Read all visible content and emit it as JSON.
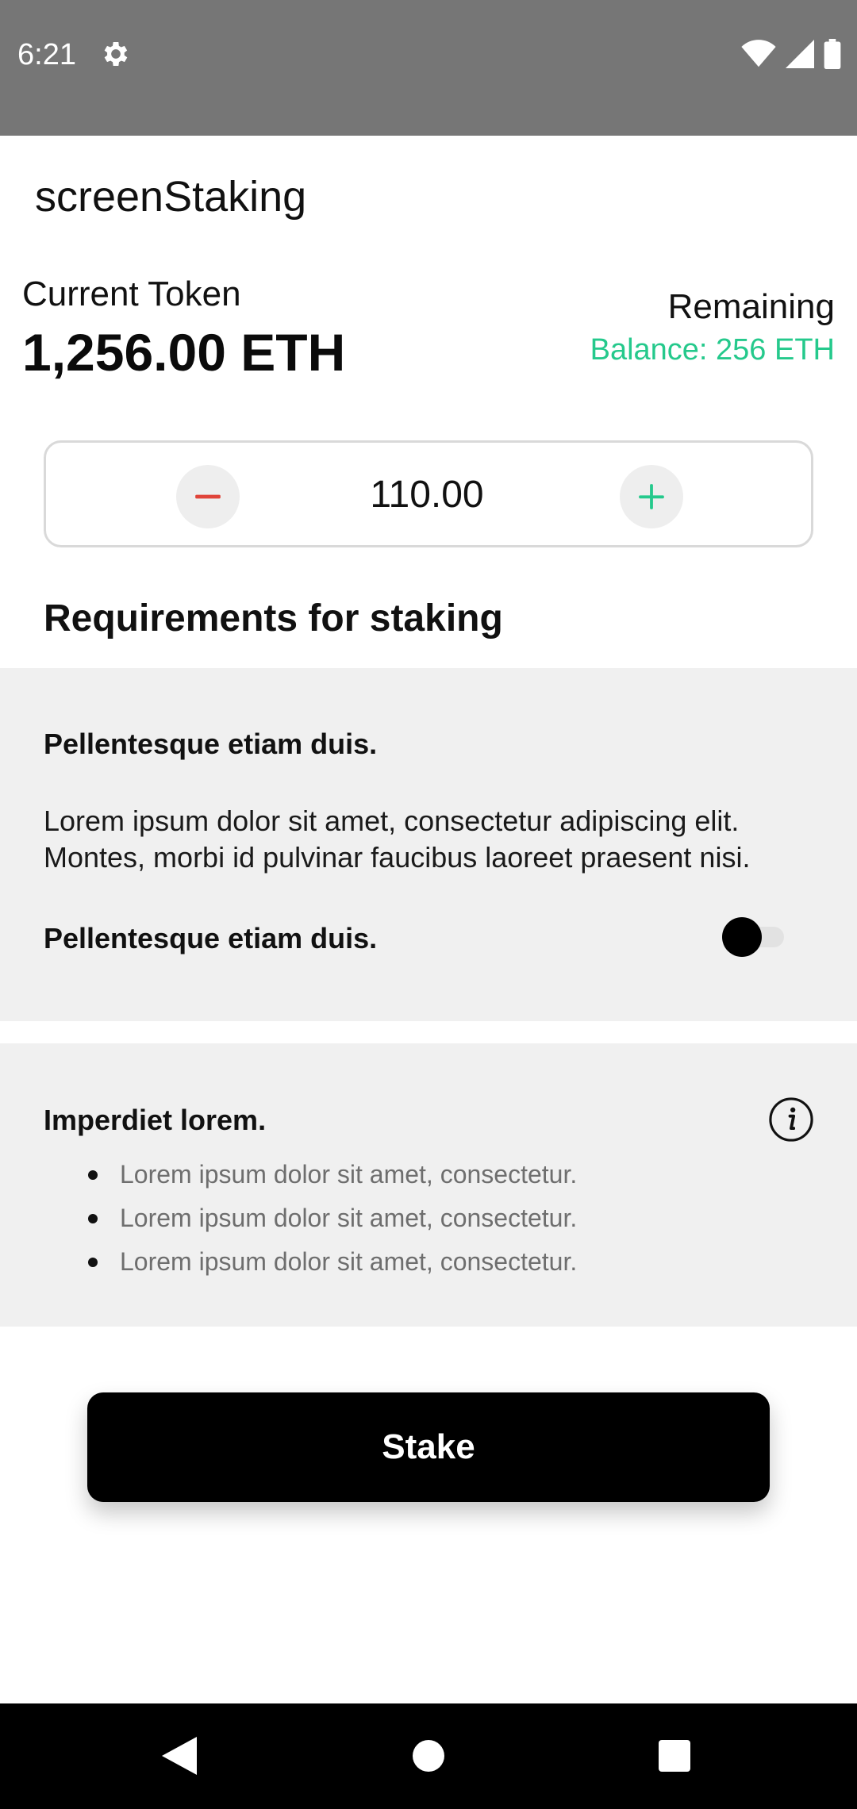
{
  "status_bar": {
    "time": "6:21",
    "icons": [
      "gear-icon",
      "wifi-icon",
      "cell-signal-icon",
      "battery-icon"
    ]
  },
  "app_bar": {
    "title": "screenStaking"
  },
  "token": {
    "current_label": "Current Token",
    "current_value": "1,256.00 ETH",
    "remaining_label": "Remaining",
    "remaining_balance": "Balance: 256 ETH"
  },
  "stepper": {
    "value": "110.00",
    "minus_icon": "minus-icon",
    "plus_icon": "plus-icon"
  },
  "requirements": {
    "title": "Requirements for staking",
    "card1": {
      "heading1": "Pellentesque etiam duis.",
      "body": "Lorem ipsum dolor sit amet, consectetur adipiscing elit. Montes, morbi id pulvinar faucibus laoreet praesent nisi.",
      "heading2": "Pellentesque etiam duis.",
      "toggle_on": false
    },
    "card2": {
      "heading": "Imperdiet lorem.",
      "info_icon": "info-icon",
      "items": [
        "Lorem ipsum dolor sit amet, consectetur.",
        "Lorem ipsum dolor sit amet, consectetur.",
        "Lorem ipsum dolor sit amet, consectetur."
      ]
    }
  },
  "stake_button": {
    "label": "Stake"
  },
  "nav_bar": {
    "icons": [
      "back-icon",
      "home-icon",
      "recents-icon"
    ]
  },
  "colors": {
    "accent_green": "#25c98c",
    "minus_red": "#e0443a",
    "status_bar": "#767676",
    "card_bg": "#f0f0f0",
    "button_bg": "#000000"
  }
}
